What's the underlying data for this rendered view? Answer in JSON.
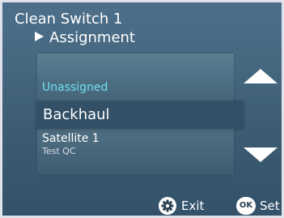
{
  "header": {
    "title": "Clean Switch 1",
    "subtitle": "Assignment"
  },
  "list": {
    "items": [
      {
        "label": "Unassigned",
        "color": "#6ee0ef"
      },
      {
        "label": "Backhaul",
        "selected": true
      },
      {
        "label": "Satellite 1",
        "sublabel": "Test QC"
      }
    ]
  },
  "scroll": {
    "up_icon": "triangle-up",
    "down_icon": "triangle-down"
  },
  "footer": {
    "exit": {
      "icon": "gear-icon",
      "label": "Exit"
    },
    "set": {
      "badge": "OK",
      "label": "Set"
    }
  },
  "colors": {
    "background": "#45677f",
    "selection": "#335066",
    "accent": "#6ee0ef"
  }
}
